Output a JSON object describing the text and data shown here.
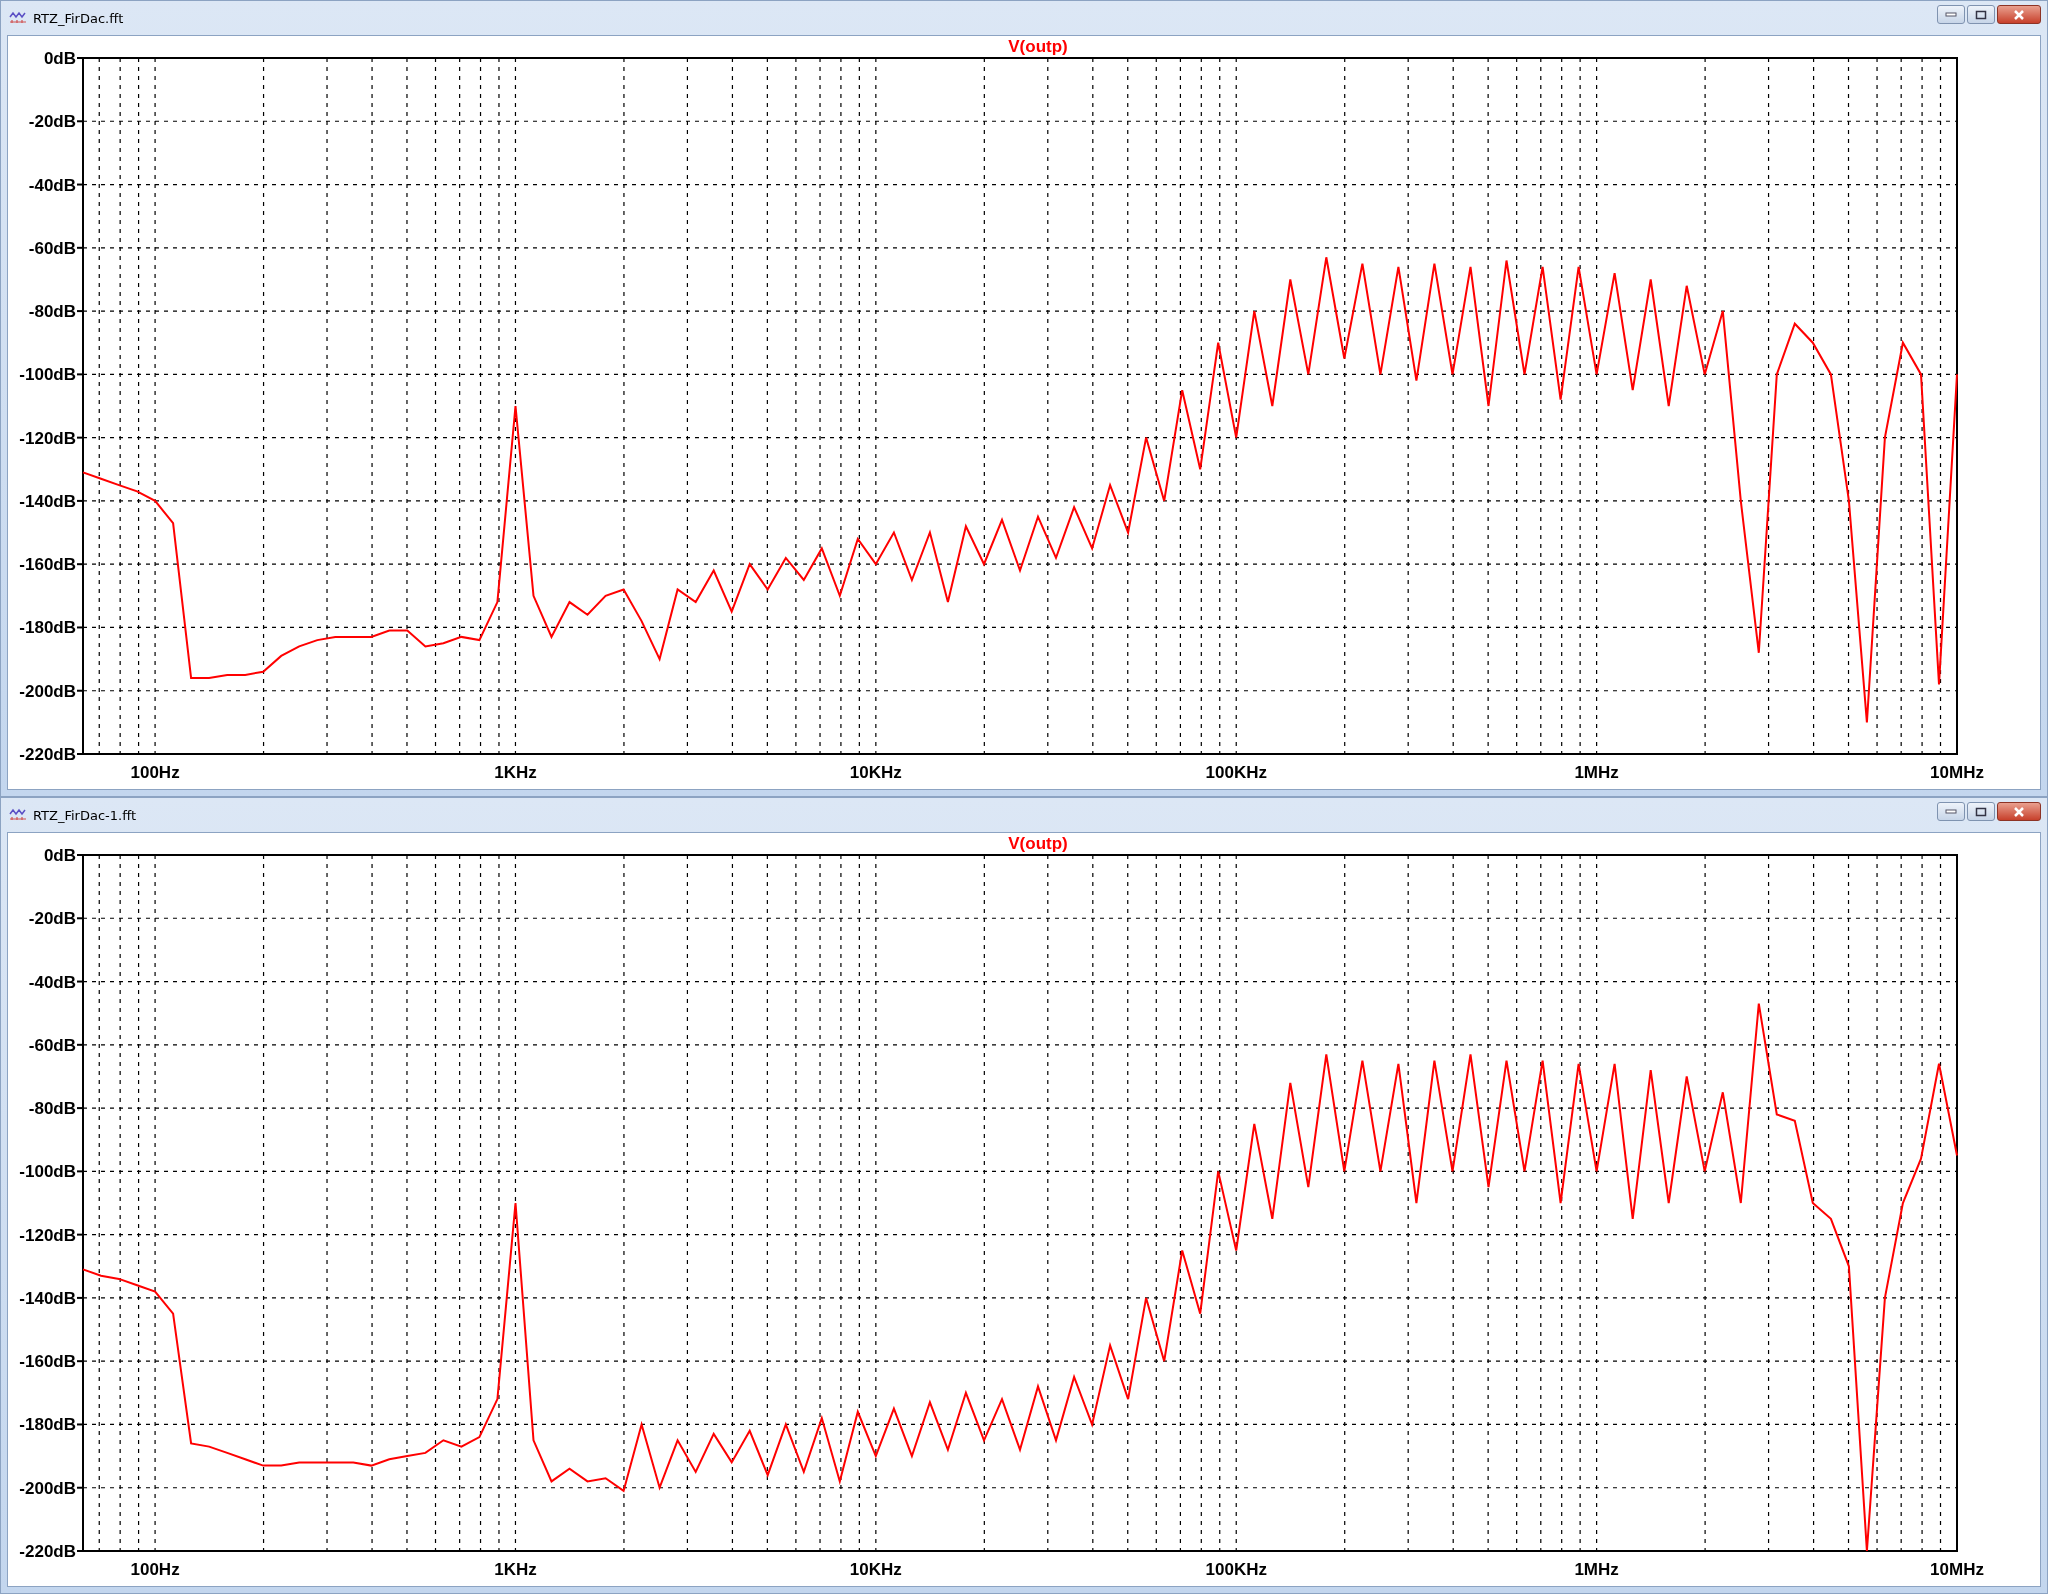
{
  "windows": [
    {
      "title": "RTZ_FirDac.fft",
      "chart_data": {
        "type": "line",
        "grid": true,
        "ylim": [
          -220,
          0
        ],
        "categories": [
          null,
          null,
          null,
          null,
          "100Hz",
          null,
          null,
          null,
          null,
          null,
          null,
          null,
          null,
          null,
          null,
          null,
          null,
          null,
          null,
          null,
          null,
          null,
          null,
          null,
          "1KHz",
          null,
          null,
          null,
          null,
          null,
          null,
          null,
          null,
          null,
          null,
          null,
          null,
          null,
          null,
          null,
          null,
          null,
          null,
          null,
          "10KHz",
          null,
          null,
          null,
          null,
          null,
          null,
          null,
          null,
          null,
          null,
          null,
          null,
          null,
          null,
          null,
          null,
          null,
          null,
          null,
          "100KHz",
          null,
          null,
          null,
          null,
          null,
          null,
          null,
          null,
          null,
          null,
          null,
          null,
          null,
          null,
          null,
          null,
          null,
          null,
          null,
          "1MHz",
          null,
          null,
          null,
          null,
          null,
          null,
          null,
          null,
          null,
          null,
          null,
          null,
          null,
          null,
          null,
          null,
          null,
          null,
          null,
          "10MHz"
        ],
        "yticks": [
          {
            "value": 0,
            "label": "0dB"
          },
          {
            "value": -20,
            "label": "-20dB"
          },
          {
            "value": -40,
            "label": "-40dB"
          },
          {
            "value": -60,
            "label": "-60dB"
          },
          {
            "value": -80,
            "label": "-80dB"
          },
          {
            "value": -100,
            "label": "-100dB"
          },
          {
            "value": -120,
            "label": "-120dB"
          },
          {
            "value": -140,
            "label": "-140dB"
          },
          {
            "value": -160,
            "label": "-160dB"
          },
          {
            "value": -180,
            "label": "-180dB"
          },
          {
            "value": -200,
            "label": "-200dB"
          },
          {
            "value": -220,
            "label": "-220dB"
          }
        ],
        "series": [
          {
            "name": "V(outp)",
            "color": "#ff0000",
            "values": [
              -131,
              -133,
              -135,
              -137,
              -140,
              -147,
              -196,
              -196,
              -195,
              -195,
              -194,
              -189,
              -186,
              -184,
              -183,
              -183,
              -183,
              -181,
              -181,
              -186,
              -185,
              -183,
              -184,
              -172,
              -110,
              -170,
              -183,
              -172,
              -176,
              -170,
              -168,
              -178,
              -190,
              -168,
              -172,
              -162,
              -175,
              -160,
              -168,
              -158,
              -165,
              -155,
              -170,
              -152,
              -160,
              -150,
              -165,
              -150,
              -172,
              -148,
              -160,
              -146,
              -162,
              -145,
              -158,
              -142,
              -155,
              -135,
              -150,
              -120,
              -140,
              -105,
              -130,
              -90,
              -120,
              -80,
              -110,
              -70,
              -100,
              -63,
              -95,
              -65,
              -100,
              -66,
              -102,
              -65,
              -100,
              -66,
              -110,
              -64,
              -100,
              -66,
              -108,
              -66,
              -100,
              -68,
              -105,
              -70,
              -110,
              -72,
              -100,
              -80,
              -140,
              -188,
              -100,
              -84,
              -90,
              -100,
              -140,
              -210,
              -120,
              -90,
              -100,
              -198,
              -100
            ]
          }
        ]
      }
    },
    {
      "title": "RTZ_FirDac-1.fft",
      "chart_data": {
        "type": "line",
        "grid": true,
        "ylim": [
          -220,
          0
        ],
        "categories": [
          null,
          null,
          null,
          null,
          "100Hz",
          null,
          null,
          null,
          null,
          null,
          null,
          null,
          null,
          null,
          null,
          null,
          null,
          null,
          null,
          null,
          null,
          null,
          null,
          null,
          "1KHz",
          null,
          null,
          null,
          null,
          null,
          null,
          null,
          null,
          null,
          null,
          null,
          null,
          null,
          null,
          null,
          null,
          null,
          null,
          null,
          "10KHz",
          null,
          null,
          null,
          null,
          null,
          null,
          null,
          null,
          null,
          null,
          null,
          null,
          null,
          null,
          null,
          null,
          null,
          null,
          null,
          "100KHz",
          null,
          null,
          null,
          null,
          null,
          null,
          null,
          null,
          null,
          null,
          null,
          null,
          null,
          null,
          null,
          null,
          null,
          null,
          null,
          "1MHz",
          null,
          null,
          null,
          null,
          null,
          null,
          null,
          null,
          null,
          null,
          null,
          null,
          null,
          null,
          null,
          null,
          null,
          null,
          null,
          "10MHz"
        ],
        "yticks": [
          {
            "value": 0,
            "label": "0dB"
          },
          {
            "value": -20,
            "label": "-20dB"
          },
          {
            "value": -40,
            "label": "-40dB"
          },
          {
            "value": -60,
            "label": "-60dB"
          },
          {
            "value": -80,
            "label": "-80dB"
          },
          {
            "value": -100,
            "label": "-100dB"
          },
          {
            "value": -120,
            "label": "-120dB"
          },
          {
            "value": -140,
            "label": "-140dB"
          },
          {
            "value": -160,
            "label": "-160dB"
          },
          {
            "value": -180,
            "label": "-180dB"
          },
          {
            "value": -200,
            "label": "-200dB"
          },
          {
            "value": -220,
            "label": "-220dB"
          }
        ],
        "series": [
          {
            "name": "V(outp)",
            "color": "#ff0000",
            "values": [
              -131,
              -133,
              -134,
              -136,
              -138,
              -145,
              -186,
              -187,
              -189,
              -191,
              -193,
              -193,
              -192,
              -192,
              -192,
              -192,
              -193,
              -191,
              -190,
              -189,
              -185,
              -187,
              -184,
              -172,
              -110,
              -185,
              -198,
              -194,
              -198,
              -197,
              -201,
              -180,
              -200,
              -185,
              -195,
              -183,
              -192,
              -182,
              -196,
              -180,
              -195,
              -178,
              -198,
              -176,
              -190,
              -175,
              -190,
              -173,
              -188,
              -170,
              -185,
              -172,
              -188,
              -168,
              -185,
              -165,
              -180,
              -155,
              -172,
              -140,
              -160,
              -125,
              -145,
              -100,
              -125,
              -85,
              -115,
              -72,
              -105,
              -63,
              -100,
              -65,
              -100,
              -66,
              -110,
              -65,
              -100,
              -63,
              -105,
              -65,
              -100,
              -65,
              -110,
              -66,
              -100,
              -66,
              -115,
              -68,
              -110,
              -70,
              -100,
              -75,
              -110,
              -47,
              -82,
              -84,
              -110,
              -115,
              -130,
              -220,
              -140,
              -110,
              -96,
              -66,
              -95
            ]
          }
        ]
      }
    }
  ]
}
